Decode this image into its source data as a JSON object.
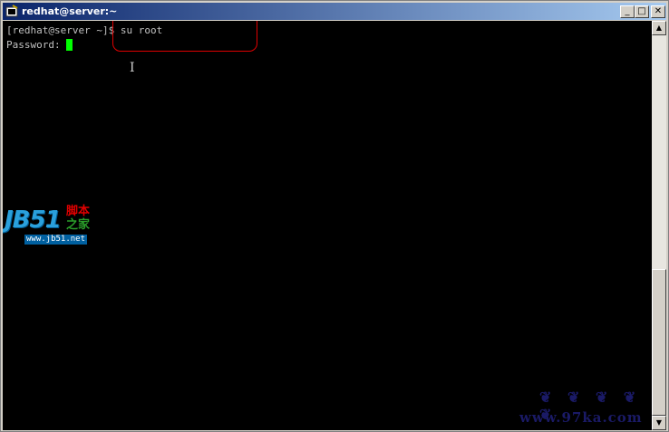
{
  "window": {
    "title": "redhat@server:~",
    "minimize_label": "_",
    "maximize_label": "□",
    "close_label": "✕"
  },
  "terminal": {
    "lines": [
      {
        "text": "[redhat@server ~]$ su root"
      },
      {
        "text": "Password: "
      }
    ],
    "cursor_color": "#00ff00"
  },
  "overlay": {
    "logo": {
      "text": "JB51",
      "cn_line1": "脚本",
      "cn_line2": "之家",
      "url": "www.jb51.net"
    },
    "watermark": {
      "line1": "❦ ❦ ❦ ❦ ❦",
      "line2": "www.97ka.com"
    },
    "highlight_color": "#e00000"
  },
  "scrollbar": {
    "up_icon": "▲",
    "down_icon": "▼"
  },
  "colors": {
    "terminal_bg": "#000000",
    "terminal_fg": "#c0c0c0",
    "titlebar_start": "#0a246a",
    "titlebar_end": "#a6caf0"
  }
}
